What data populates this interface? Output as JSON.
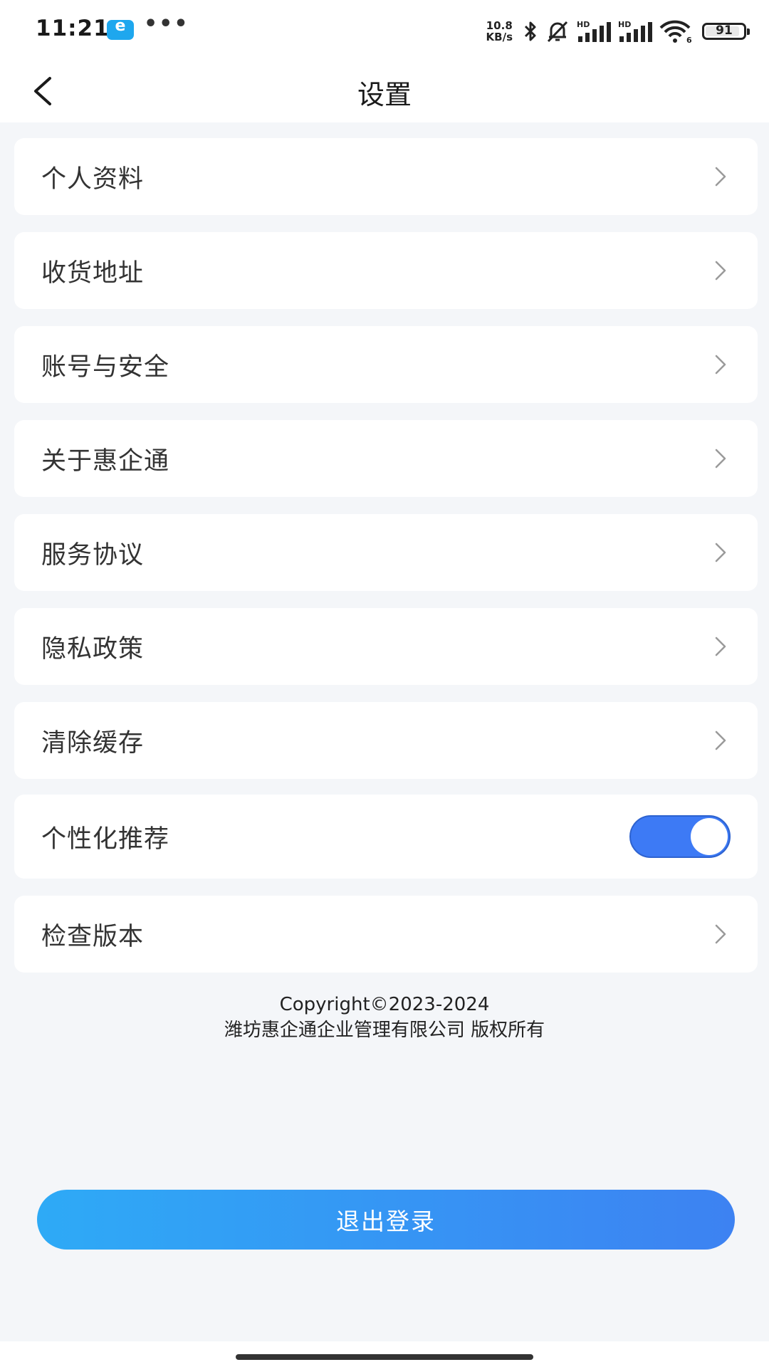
{
  "status_bar": {
    "time": "11:21",
    "app_icon": "e-app-icon",
    "more_dots": "•••",
    "net_speed_value": "10.8",
    "net_speed_unit": "KB/s",
    "signal1_label": "HD",
    "signal2_label": "HD",
    "wifi_label": "6",
    "battery_level": "91"
  },
  "header": {
    "title": "设置",
    "back_icon": "chevron-left-icon"
  },
  "settings": {
    "items": [
      {
        "label": "个人资料"
      },
      {
        "label": "收货地址"
      },
      {
        "label": "账号与安全"
      },
      {
        "label": "关于惠企通"
      },
      {
        "label": "服务协议"
      },
      {
        "label": "隐私政策"
      },
      {
        "label": "清除缓存"
      },
      {
        "label": "个性化推荐",
        "toggle_on": true
      },
      {
        "label": "检查版本"
      }
    ]
  },
  "footer": {
    "copyright_line1": "Copyright©2023-2024",
    "copyright_line2": "潍坊惠企通企业管理有限公司 版权所有"
  },
  "logout": {
    "label": "退出登录"
  },
  "colors": {
    "accent": "#3d7af5",
    "button_gradient_start": "#2eaaf6",
    "button_gradient_end": "#3d82f2",
    "page_background": "#f4f6f9"
  }
}
